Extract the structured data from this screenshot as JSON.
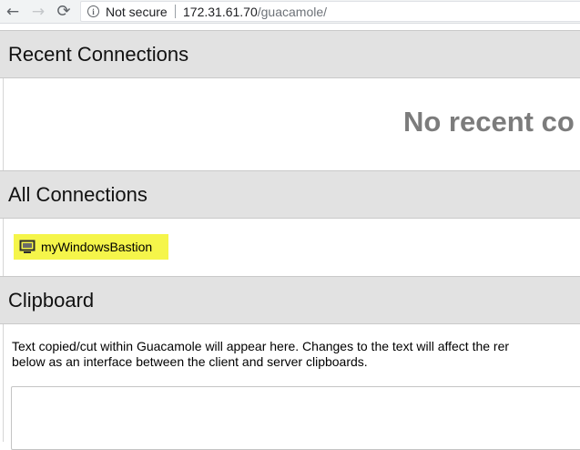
{
  "browser": {
    "back_icon": "←",
    "forward_icon": "→",
    "reload_icon": "⟳",
    "security_label": "Not secure",
    "url_host": "172.31.61.70",
    "url_path": "/guacamole/"
  },
  "recent": {
    "title": "Recent Connections",
    "empty_text": "No recent co"
  },
  "all_connections": {
    "title": "All Connections",
    "items": [
      {
        "label": "myWindowsBastion",
        "icon": "monitor-icon",
        "highlight_color": "#f5f54a"
      }
    ]
  },
  "clipboard": {
    "title": "Clipboard",
    "description_line1": "Text copied/cut within Guacamole will appear here. Changes to the text will affect the rer",
    "description_line2": "below as an interface between the client and server clipboards.",
    "value": ""
  }
}
